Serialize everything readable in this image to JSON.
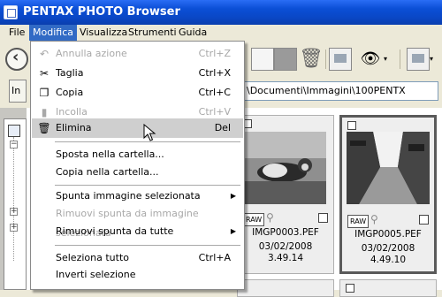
{
  "window": {
    "title": "PENTAX PHOTO Browser"
  },
  "menubar": {
    "items": [
      "File",
      "Modifica",
      "Visualizza",
      "Strumenti",
      "Guida"
    ]
  },
  "toolbar": {
    "icons": [
      "back-icon",
      "copy-doc-icon",
      "paste-doc-icon",
      "trash-icon",
      "image-frame-icon",
      "eye-icon",
      "dropdown-icon",
      "layers-icon"
    ]
  },
  "address": {
    "button_label": "In",
    "path": "\\Documenti\\Immagini\\100PENTX"
  },
  "edit_menu": {
    "items": [
      {
        "label": "Annulla azione",
        "shortcut": "Ctrl+Z",
        "enabled": false,
        "icon": "undo-icon"
      },
      {
        "label": "Taglia",
        "shortcut": "Ctrl+X",
        "enabled": true,
        "icon": "scissors-icon"
      },
      {
        "label": "Copia",
        "shortcut": "Ctrl+C",
        "enabled": true,
        "icon": "copy-icon"
      },
      {
        "label": "Incolla",
        "shortcut": "Ctrl+V",
        "enabled": false,
        "icon": "paste-icon"
      },
      {
        "label": "Elimina",
        "shortcut": "Del",
        "enabled": true,
        "icon": "trash-icon",
        "highlighted": true
      },
      {
        "label": "Sposta nella cartella...",
        "shortcut": "",
        "enabled": true
      },
      {
        "label": "Copia nella cartella...",
        "shortcut": "",
        "enabled": true
      },
      {
        "label": "Spunta immagine selezionata",
        "shortcut": "",
        "enabled": true,
        "submenu": true
      },
      {
        "label": "Rimuovi spunta da immagine selezionata",
        "shortcut": "",
        "enabled": false
      },
      {
        "label": "Rimuovi spunta da tutte",
        "shortcut": "",
        "enabled": true,
        "submenu": true
      },
      {
        "label": "Seleziona tutto",
        "shortcut": "Ctrl+A",
        "enabled": true
      },
      {
        "label": "Inverti selezione",
        "shortcut": "",
        "enabled": true
      }
    ]
  },
  "thumbnails": [
    {
      "filename": "IMGP0003.PEF",
      "date": "03/02/2008",
      "time": "3.49.14",
      "badge": "RAW",
      "selected": false
    },
    {
      "filename": "IMGP0005.PEF",
      "date": "03/02/2008",
      "time": "4.49.10",
      "badge": "RAW",
      "selected": true
    }
  ]
}
